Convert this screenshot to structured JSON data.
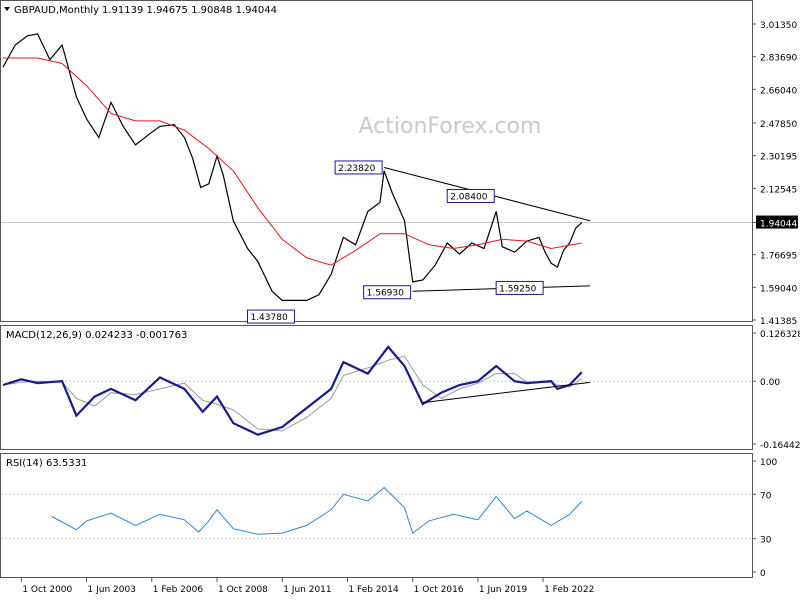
{
  "header": {
    "symbol": "GBPAUD,Monthly",
    "ohlc": "1.91139 1.94675 1.90848 1.94044"
  },
  "watermark": "ActionForex.com",
  "colors": {
    "price": "#000000",
    "ma": "#e0191d",
    "macd_line": "#1a1a8c",
    "macd_signal": "#9a9a9a",
    "rsi": "#2f86d6",
    "trendline": "#000000",
    "grid": "#c8c8c8"
  },
  "chart_data": [
    {
      "type": "candlestick",
      "title": "GBPAUD,Monthly",
      "ohlc_label": "1.91139 1.94675 1.90848 1.94044",
      "ylim": [
        1.41385,
        3.0135
      ],
      "y_ticks": [
        "3.01350",
        "2.83690",
        "2.66040",
        "2.47850",
        "2.30195",
        "2.12545",
        "1.94044",
        "1.76695",
        "1.59040",
        "1.41385"
      ],
      "last_price": "1.94044",
      "close_series": [
        {
          "x": "2000-01",
          "y": 2.78
        },
        {
          "x": "2000-07",
          "y": 2.9
        },
        {
          "x": "2001-01",
          "y": 2.95
        },
        {
          "x": "2001-06",
          "y": 2.96
        },
        {
          "x": "2001-12",
          "y": 2.82
        },
        {
          "x": "2002-06",
          "y": 2.9
        },
        {
          "x": "2003-01",
          "y": 2.62
        },
        {
          "x": "2003-06",
          "y": 2.5
        },
        {
          "x": "2003-12",
          "y": 2.4
        },
        {
          "x": "2004-06",
          "y": 2.59
        },
        {
          "x": "2004-12",
          "y": 2.46
        },
        {
          "x": "2005-06",
          "y": 2.36
        },
        {
          "x": "2006-01",
          "y": 2.42
        },
        {
          "x": "2006-06",
          "y": 2.46
        },
        {
          "x": "2007-01",
          "y": 2.47
        },
        {
          "x": "2007-06",
          "y": 2.4
        },
        {
          "x": "2007-10",
          "y": 2.29
        },
        {
          "x": "2008-02",
          "y": 2.13
        },
        {
          "x": "2008-06",
          "y": 2.15
        },
        {
          "x": "2008-10",
          "y": 2.3
        },
        {
          "x": "2009-01",
          "y": 2.2
        },
        {
          "x": "2009-06",
          "y": 1.95
        },
        {
          "x": "2010-01",
          "y": 1.8
        },
        {
          "x": "2010-06",
          "y": 1.73
        },
        {
          "x": "2011-01",
          "y": 1.57
        },
        {
          "x": "2011-06",
          "y": 1.52
        },
        {
          "x": "2011-12",
          "y": 1.52
        },
        {
          "x": "2012-06",
          "y": 1.52
        },
        {
          "x": "2012-12",
          "y": 1.55
        },
        {
          "x": "2013-06",
          "y": 1.66
        },
        {
          "x": "2013-12",
          "y": 1.86
        },
        {
          "x": "2014-06",
          "y": 1.82
        },
        {
          "x": "2014-12",
          "y": 2.0
        },
        {
          "x": "2015-06",
          "y": 2.05
        },
        {
          "x": "2015-08",
          "y": 2.22
        },
        {
          "x": "2015-12",
          "y": 2.1
        },
        {
          "x": "2016-06",
          "y": 1.95
        },
        {
          "x": "2016-10",
          "y": 1.62
        },
        {
          "x": "2017-03",
          "y": 1.63
        },
        {
          "x": "2017-09",
          "y": 1.71
        },
        {
          "x": "2018-03",
          "y": 1.83
        },
        {
          "x": "2018-09",
          "y": 1.77
        },
        {
          "x": "2019-03",
          "y": 1.83
        },
        {
          "x": "2019-09",
          "y": 1.8
        },
        {
          "x": "2020-03",
          "y": 2.0
        },
        {
          "x": "2020-06",
          "y": 1.81
        },
        {
          "x": "2020-12",
          "y": 1.78
        },
        {
          "x": "2021-06",
          "y": 1.84
        },
        {
          "x": "2021-12",
          "y": 1.86
        },
        {
          "x": "2022-03",
          "y": 1.78
        },
        {
          "x": "2022-06",
          "y": 1.72
        },
        {
          "x": "2022-09",
          "y": 1.7
        },
        {
          "x": "2022-12",
          "y": 1.79
        },
        {
          "x": "2023-03",
          "y": 1.83
        },
        {
          "x": "2023-06",
          "y": 1.91
        },
        {
          "x": "2023-09",
          "y": 1.94
        }
      ],
      "ma_series": [
        {
          "x": "2000-01",
          "y": 2.83
        },
        {
          "x": "2001-06",
          "y": 2.83
        },
        {
          "x": "2002-06",
          "y": 2.8
        },
        {
          "x": "2003-06",
          "y": 2.68
        },
        {
          "x": "2004-06",
          "y": 2.53
        },
        {
          "x": "2005-06",
          "y": 2.49
        },
        {
          "x": "2006-06",
          "y": 2.49
        },
        {
          "x": "2007-06",
          "y": 2.44
        },
        {
          "x": "2008-06",
          "y": 2.34
        },
        {
          "x": "2009-06",
          "y": 2.22
        },
        {
          "x": "2010-06",
          "y": 2.02
        },
        {
          "x": "2011-06",
          "y": 1.85
        },
        {
          "x": "2012-06",
          "y": 1.75
        },
        {
          "x": "2013-06",
          "y": 1.71
        },
        {
          "x": "2014-06",
          "y": 1.79
        },
        {
          "x": "2015-06",
          "y": 1.88
        },
        {
          "x": "2016-06",
          "y": 1.88
        },
        {
          "x": "2017-06",
          "y": 1.82
        },
        {
          "x": "2018-06",
          "y": 1.8
        },
        {
          "x": "2019-06",
          "y": 1.82
        },
        {
          "x": "2020-06",
          "y": 1.85
        },
        {
          "x": "2021-06",
          "y": 1.84
        },
        {
          "x": "2022-06",
          "y": 1.8
        },
        {
          "x": "2023-09",
          "y": 1.83
        }
      ],
      "annotations": [
        {
          "label": "2.23820",
          "x": "2015-08",
          "y": 2.2382
        },
        {
          "label": "2.08400",
          "x": "2020-03",
          "y": 2.084
        },
        {
          "label": "1.43780",
          "x": "2012-01",
          "y": 1.4378
        },
        {
          "label": "1.56930",
          "x": "2016-10",
          "y": 1.5693
        },
        {
          "label": "1.59250",
          "x": "2022-03",
          "y": 1.5925
        }
      ],
      "trendlines": [
        {
          "from": {
            "x": "2015-08",
            "y": 2.2382
          },
          "to": {
            "x": "2024-01",
            "y": 1.95
          }
        },
        {
          "from": {
            "x": "2016-10",
            "y": 1.5693
          },
          "to": {
            "x": "2024-01",
            "y": 1.5985
          }
        }
      ]
    },
    {
      "type": "line",
      "title": "MACD(12,26,9) 0.024233 -0.001763",
      "ylim": [
        -0.164422,
        0.126328
      ],
      "y_ticks": [
        "0.126328",
        "0.00",
        "-0.164422"
      ],
      "series": [
        {
          "name": "MACD",
          "values": [
            {
              "x": "2000-01",
              "y": -0.01
            },
            {
              "x": "2000-10",
              "y": 0.005
            },
            {
              "x": "2001-06",
              "y": -0.005
            },
            {
              "x": "2002-06",
              "y": 0.0
            },
            {
              "x": "2003-01",
              "y": -0.09
            },
            {
              "x": "2003-10",
              "y": -0.04
            },
            {
              "x": "2004-06",
              "y": -0.02
            },
            {
              "x": "2005-06",
              "y": -0.05
            },
            {
              "x": "2006-06",
              "y": 0.01
            },
            {
              "x": "2007-06",
              "y": -0.02
            },
            {
              "x": "2008-03",
              "y": -0.08
            },
            {
              "x": "2008-10",
              "y": -0.04
            },
            {
              "x": "2009-06",
              "y": -0.11
            },
            {
              "x": "2010-06",
              "y": -0.14
            },
            {
              "x": "2011-06",
              "y": -0.12
            },
            {
              "x": "2012-06",
              "y": -0.07
            },
            {
              "x": "2013-06",
              "y": -0.02
            },
            {
              "x": "2013-12",
              "y": 0.05
            },
            {
              "x": "2014-12",
              "y": 0.02
            },
            {
              "x": "2015-10",
              "y": 0.09
            },
            {
              "x": "2016-06",
              "y": 0.04
            },
            {
              "x": "2017-03",
              "y": -0.06
            },
            {
              "x": "2017-12",
              "y": -0.03
            },
            {
              "x": "2018-09",
              "y": -0.01
            },
            {
              "x": "2019-06",
              "y": 0.0
            },
            {
              "x": "2020-03",
              "y": 0.04
            },
            {
              "x": "2020-12",
              "y": 0.0
            },
            {
              "x": "2021-06",
              "y": -0.005
            },
            {
              "x": "2022-06",
              "y": 0.0
            },
            {
              "x": "2022-09",
              "y": -0.02
            },
            {
              "x": "2023-03",
              "y": -0.01
            },
            {
              "x": "2023-09",
              "y": 0.024
            }
          ]
        }
      ],
      "trendlines": [
        {
          "from": {
            "x": "2017-03",
            "y": -0.056
          },
          "to": {
            "x": "2024-01",
            "y": -0.003
          }
        }
      ]
    },
    {
      "type": "line",
      "title": "RSI(14) 63.5331",
      "ylim": [
        0,
        100
      ],
      "y_ticks": [
        "100",
        "70",
        "30",
        "0"
      ],
      "series": [
        {
          "name": "RSI(14)",
          "values": [
            {
              "x": "2002-01",
              "y": 50
            },
            {
              "x": "2002-06",
              "y": 45
            },
            {
              "x": "2003-01",
              "y": 38
            },
            {
              "x": "2003-06",
              "y": 46
            },
            {
              "x": "2004-06",
              "y": 53
            },
            {
              "x": "2005-06",
              "y": 42
            },
            {
              "x": "2006-06",
              "y": 52
            },
            {
              "x": "2007-06",
              "y": 47
            },
            {
              "x": "2008-01",
              "y": 36
            },
            {
              "x": "2008-06",
              "y": 46
            },
            {
              "x": "2008-10",
              "y": 56
            },
            {
              "x": "2009-06",
              "y": 39
            },
            {
              "x": "2010-06",
              "y": 34
            },
            {
              "x": "2011-06",
              "y": 35
            },
            {
              "x": "2012-06",
              "y": 42
            },
            {
              "x": "2013-06",
              "y": 56
            },
            {
              "x": "2013-12",
              "y": 70
            },
            {
              "x": "2014-12",
              "y": 64
            },
            {
              "x": "2015-08",
              "y": 76
            },
            {
              "x": "2016-06",
              "y": 58
            },
            {
              "x": "2016-10",
              "y": 35
            },
            {
              "x": "2017-06",
              "y": 46
            },
            {
              "x": "2018-06",
              "y": 52
            },
            {
              "x": "2019-06",
              "y": 47
            },
            {
              "x": "2020-03",
              "y": 68
            },
            {
              "x": "2020-12",
              "y": 48
            },
            {
              "x": "2021-06",
              "y": 55
            },
            {
              "x": "2022-06",
              "y": 42
            },
            {
              "x": "2023-03",
              "y": 52
            },
            {
              "x": "2023-09",
              "y": 63.5
            }
          ]
        }
      ],
      "levels": [
        70,
        30
      ]
    }
  ],
  "x_axis": {
    "labels": [
      "1 Oct 2000",
      "1 Jun 2003",
      "1 Feb 2006",
      "1 Oct 2008",
      "1 Jun 2011",
      "1 Feb 2014",
      "1 Oct 2016",
      "1 Jun 2019",
      "1 Feb 2022"
    ]
  }
}
